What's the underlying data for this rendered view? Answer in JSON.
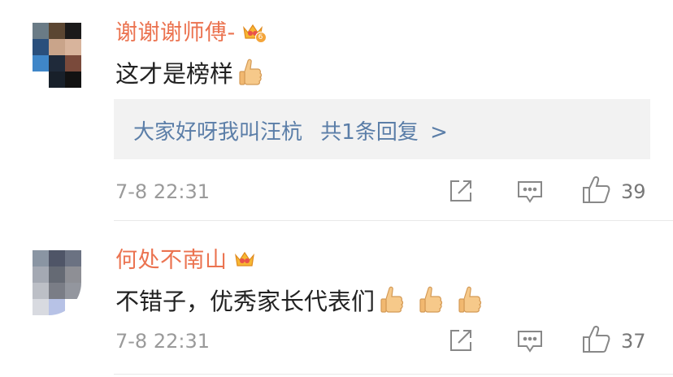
{
  "comments": [
    {
      "username": "谢谢谢师傅-",
      "vip_level": "6",
      "text": "这才是榜样",
      "reply": {
        "author": "大家好呀我叫汪杭",
        "count_text": "共1条回复",
        "arrow": ">"
      },
      "timestamp": "7-8 22:31",
      "likes": "39"
    },
    {
      "username": "何处不南山",
      "text": "不错子，优秀家长代表们",
      "timestamp": "7-8 22:31",
      "likes": "37"
    }
  ],
  "icons": {
    "share": "share-icon",
    "comment": "comment-icon",
    "like": "thumbs-up-icon",
    "emoji": "thumbs-up-emoji",
    "vip": "vip-crown-icon"
  },
  "colors": {
    "username": "#eb7350",
    "reply_link": "#5b7ea8",
    "meta": "#9a9a9a",
    "reply_bg": "#f2f2f2"
  }
}
